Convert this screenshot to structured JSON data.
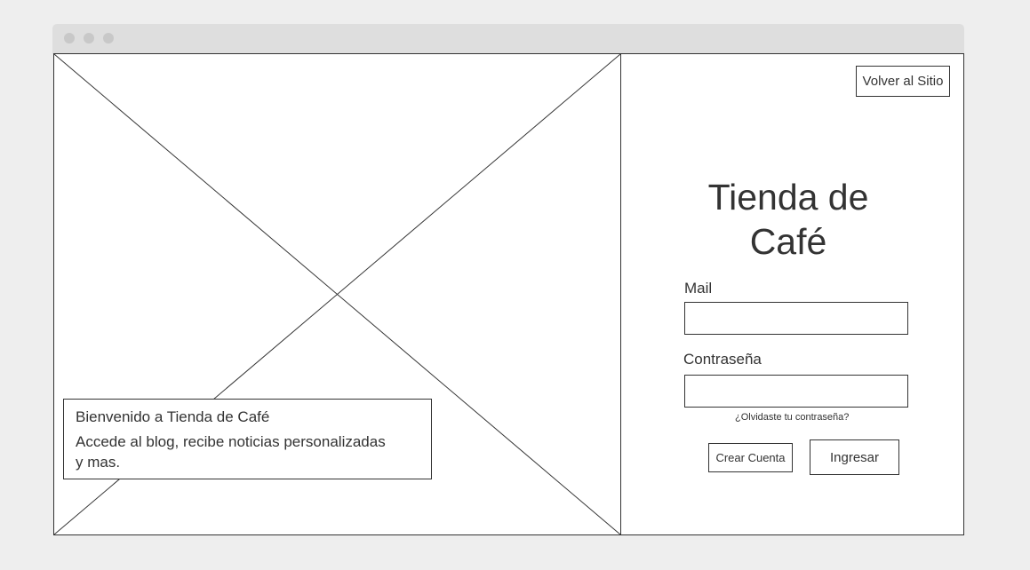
{
  "browser": {
    "window_controls": [
      "close-dot",
      "minimize-dot",
      "maximize-dot"
    ]
  },
  "hero": {
    "image_placeholder_icon": "image-placeholder-icon",
    "welcome_title": "Bienvenido a Tienda de Café",
    "welcome_text": "Accede al blog, recibe noticias personalizadas y mas."
  },
  "header": {
    "back_label": "Volver al Sitio"
  },
  "login": {
    "title": "Tienda de Café",
    "mail_label": "Mail",
    "mail_value": "",
    "password_label": "Contraseña",
    "password_value": "",
    "forgot_label": "¿Olvidaste tu contraseña?",
    "create_account_label": "Crear Cuenta",
    "submit_label": "Ingresar"
  }
}
